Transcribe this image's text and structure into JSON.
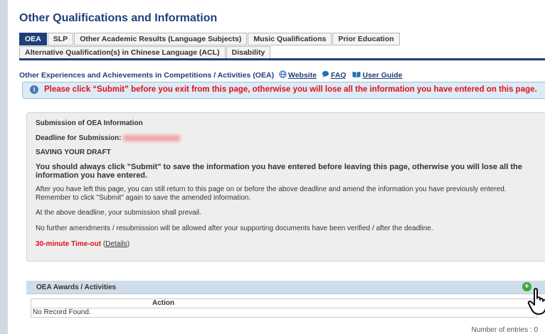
{
  "page": {
    "title": "Other Qualifications and Information"
  },
  "tabs": [
    {
      "label": "OEA",
      "active": true
    },
    {
      "label": "SLP",
      "active": false
    },
    {
      "label": "Other Academic Results (Language Subjects)",
      "active": false
    },
    {
      "label": "Music Qualifications",
      "active": false
    },
    {
      "label": "Prior Education",
      "active": false
    },
    {
      "label": "Alternative Qualification(s) in Chinese Language (ACL)",
      "active": false
    },
    {
      "label": "Disability",
      "active": false
    }
  ],
  "section": {
    "title": "Other Experiences and Achievements in Competitions / Activities (OEA)",
    "links": {
      "website": "Website",
      "faq": "FAQ",
      "user_guide": "User Guide"
    },
    "icons": {
      "website": "globe-icon",
      "faq": "chat-bubble-icon",
      "user_guide": "book-icon"
    }
  },
  "notice": {
    "icon": "info-icon",
    "text": "Please click “Submit” before you exit from this page, otherwise you will lose all the information you have entered on this page."
  },
  "submission": {
    "heading": "Submission of OEA Information",
    "deadline_label": "Deadline for Submission:",
    "saving_label": "SAVING YOUR DRAFT",
    "warning": "You should always click \"Submit\" to save the information you have entered before leaving this page, otherwise you will lose all the information you have entered.",
    "para1": "After you have left this page, you can still return to this page on or before the above deadline and amend the information you have previously entered. Remember to click \"Submit\" again to save the amended information.",
    "para2": "At the above deadline, your submission shall prevail.",
    "para3": "No further amendments / resubmission will be allowed after your supporting documents have been verified / after the deadline.",
    "timeout_label": "30-minute Time-out",
    "details_link": "Details"
  },
  "awards": {
    "title": "OEA Awards / Activities",
    "add_icon": "add-icon",
    "columns": [
      "Action"
    ],
    "empty_text": "No Record Found.",
    "entries_text": "Number of entries : 0"
  },
  "colors": {
    "primary": "#1f3f7a",
    "alert_red": "#e0101c",
    "notice_bg": "#dcebf5",
    "panel_bg": "#eeeeee",
    "awards_bar": "#cfdde9",
    "add_green": "#3fa83f"
  }
}
